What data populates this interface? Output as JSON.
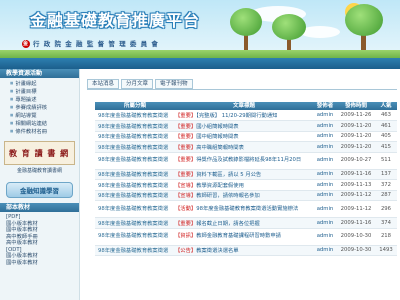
{
  "header": {
    "title": "金融基礎教育推廣平台",
    "subtitle": "行 政 院 金 融 監 督 管 理 委 員 會",
    "logo_glyph": "金"
  },
  "sidebar": {
    "section1_title": "教學資源活動",
    "section1_items": [
      "計畫緣起",
      "計畫目標",
      "專題論述",
      "參賽成績評核",
      "網站導覽",
      "相關網站連結",
      "條件教材名冊"
    ],
    "book_banner_text": "教 育 讀 書 網",
    "book_caption": "金融基礎教育讀書網",
    "learn_button": "金融知識學習",
    "section2_title": "部本教材",
    "section2_items": [
      "[PDF]",
      "國小版本教材",
      "國中版本教材",
      "高中教師手冊",
      "高中版本教材",
      "[ODT]",
      "國小版本教材",
      "國中版本教材"
    ]
  },
  "main": {
    "tabs": [
      "本站消息",
      "分月文章",
      "電子報刊物"
    ],
    "columns": [
      "所屬分類",
      "文章標題",
      "發佈者",
      "發佈時間",
      "人氣"
    ],
    "rows": [
      {
        "category": "98年度金融基礎教育教案徵選",
        "tag": "【重要】",
        "title": "【完整版】 11/20-29期間行動通知",
        "author": "admin",
        "date": "2009-11-26",
        "hits": "463"
      },
      {
        "category": "98年度金融基礎教育教案徵選",
        "tag": "【重要】",
        "title": "國小組簡報時間表",
        "author": "admin",
        "date": "2009-11-20",
        "hits": "461"
      },
      {
        "category": "98年度金融基礎教育教案徵選",
        "tag": "【重要】",
        "title": "國中組簡報時間表",
        "author": "admin",
        "date": "2009-11-20",
        "hits": "405"
      },
      {
        "category": "98年度金融基礎教育教案徵選",
        "tag": "【重要】",
        "title": "高中職組簡報時間表",
        "author": "admin",
        "date": "2009-11-20",
        "hits": "415"
      },
      {
        "category": "98年度金融基礎教育教案徵選",
        "tag": "【重要】",
        "title": "得獎作品及試教錄影檔將延長98年11月20日",
        "author": "admin",
        "date": "2009-10-27",
        "hits": "511"
      },
      {
        "category": "98年度金融基礎教育教案徵選",
        "tag": "【重要】",
        "title": "資料下載區，請以 5 月公告",
        "author": "admin",
        "date": "2009-11-16",
        "hits": "137"
      },
      {
        "category": "98年度金融基礎教育教案徵選",
        "tag": "【宣導】",
        "title": "教學資源配套假使用",
        "author": "admin",
        "date": "2009-11-13",
        "hits": "372"
      },
      {
        "category": "98年度金融基礎教育教案徵選",
        "tag": "【宣導】",
        "title": "教師研習，請依時報名參加",
        "author": "admin",
        "date": "2009-11-12",
        "hits": "287"
      },
      {
        "category": "98年度金融基礎教育教案徵選",
        "tag": "【活動】",
        "title": "98年度金融基礎教育教案徵選活動實施辦法",
        "author": "admin",
        "date": "2009-11-12",
        "hits": "296"
      },
      {
        "category": "98年度金融基礎教育教案徵選",
        "tag": "【重要】",
        "title": "報名截止日期，請各位把握",
        "author": "admin",
        "date": "2009-11-16",
        "hits": "374"
      },
      {
        "category": "98年度金融基礎教育教案徵選",
        "tag": "【資訊】",
        "title": "教師金融教育基礎課程研習時數申請",
        "author": "admin",
        "date": "2009-10-30",
        "hits": "218"
      },
      {
        "category": "98年度金融基礎教育教案徵選",
        "tag": "【公告】",
        "title": "教案徵選決選名單",
        "author": "admin",
        "date": "2009-10-30",
        "hits": "1493"
      }
    ]
  }
}
